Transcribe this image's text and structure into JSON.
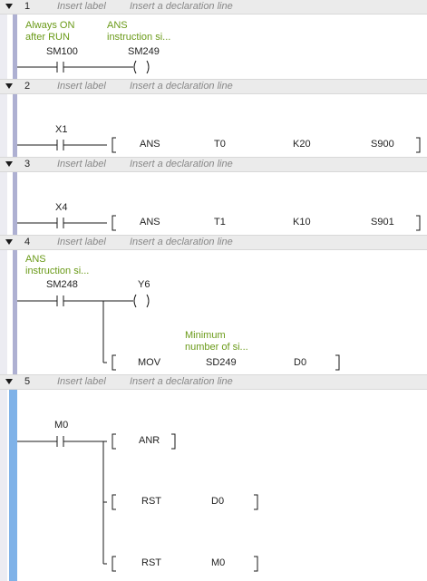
{
  "blocks": [
    {
      "num": "1",
      "label": "Insert label",
      "decl": "Insert a declaration line"
    },
    {
      "num": "2",
      "label": "Insert label",
      "decl": "Insert a declaration line"
    },
    {
      "num": "3",
      "label": "Insert label",
      "decl": "Insert a declaration line"
    },
    {
      "num": "4",
      "label": "Insert label",
      "decl": "Insert a declaration line"
    },
    {
      "num": "5",
      "label": "Insert label",
      "decl": "Insert a declaration line"
    }
  ],
  "rung1": {
    "comment1_line1": "Always ON",
    "comment1_line2": "after RUN",
    "comment2_line1": "ANS",
    "comment2_line2": "instruction si...",
    "contact": "SM100",
    "coil": "SM249"
  },
  "rung2": {
    "contact": "X1",
    "instr": "ANS",
    "op1": "T0",
    "op2": "K20",
    "op3": "S900"
  },
  "rung3": {
    "contact": "X4",
    "instr": "ANS",
    "op1": "T1",
    "op2": "K10",
    "op3": "S901"
  },
  "rung4": {
    "comment1_line1": "ANS",
    "comment1_line2": "instruction si...",
    "contact": "SM248",
    "coil": "Y6",
    "comment2_line1": "Minimum",
    "comment2_line2": "number of si...",
    "instr": "MOV",
    "op1": "SD249",
    "op2": "D0"
  },
  "rung5": {
    "contact": "M0",
    "instr1": "ANR",
    "instr2": "RST",
    "instr2_op": "D0",
    "instr3": "RST",
    "instr3_op": "M0"
  }
}
